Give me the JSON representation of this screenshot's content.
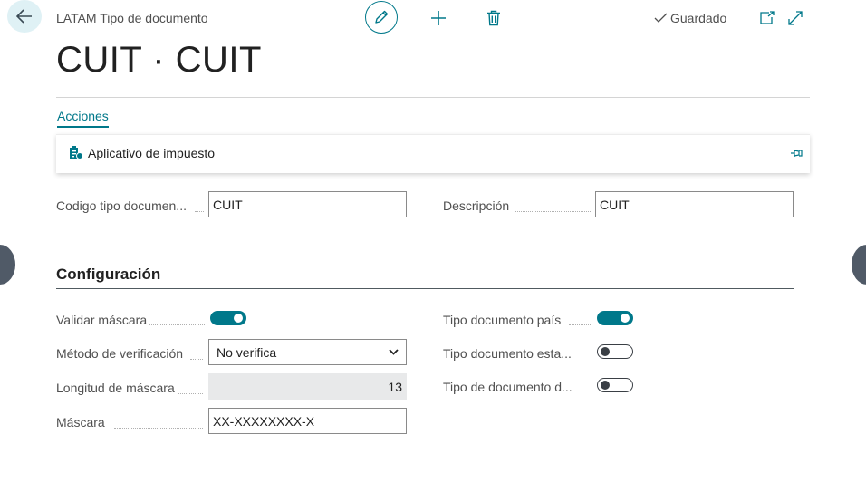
{
  "header": {
    "breadcrumb": "LATAM Tipo de documento",
    "saved_label": "Guardado"
  },
  "page": {
    "title": "CUIT · CUIT"
  },
  "actions": {
    "tab_label": "Acciones",
    "items": [
      {
        "label": "Aplicativo de impuesto",
        "icon": "tax-app-icon"
      }
    ]
  },
  "general": {
    "code_label": "Codigo tipo documen...",
    "code_value": "CUIT",
    "description_label": "Descripción",
    "description_value": "CUIT"
  },
  "configuration": {
    "title": "Configuración",
    "left": {
      "validate_mask_label": "Validar máscara",
      "validate_mask_on": true,
      "verification_method_label": "Método de verificación",
      "verification_method_value": "No verifica",
      "mask_length_label": "Longitud de máscara",
      "mask_length_value": "13",
      "mask_label": "Máscara",
      "mask_value": "XX-XXXXXXXX-X"
    },
    "right": {
      "country_doc_type_label": "Tipo documento país",
      "country_doc_type_on": true,
      "state_doc_type_label": "Tipo documento esta...",
      "state_doc_type_on": false,
      "doc_type_d_label": "Tipo de documento d...",
      "doc_type_d_on": false
    }
  },
  "colors": {
    "accent": "#00788a",
    "back_button_bg": "#dff1f5",
    "readonly_bg": "#e8e9ea"
  }
}
